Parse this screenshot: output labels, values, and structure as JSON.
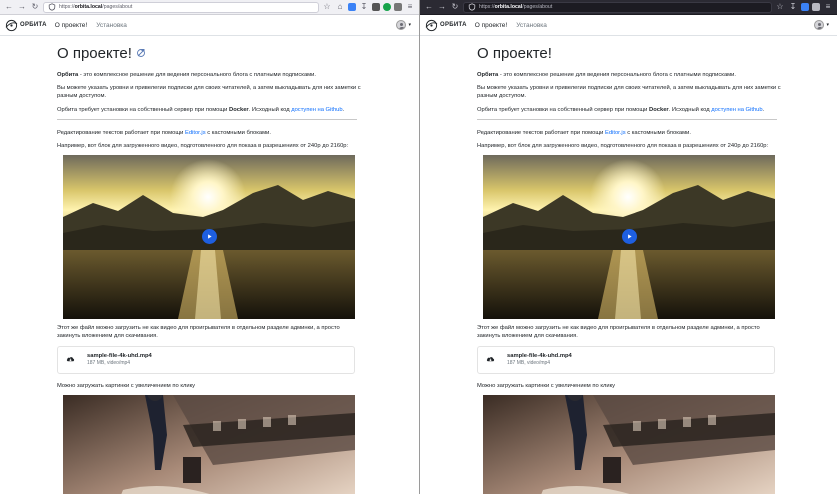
{
  "browser": {
    "url_prefix": "https://",
    "url_host": "orbita.local",
    "url_path": "/pages/about"
  },
  "site": {
    "logo_text": "ОРБИТА",
    "nav": [
      {
        "label": "О проекте!"
      },
      {
        "label": "Установка"
      }
    ]
  },
  "page": {
    "title": "О проекте!",
    "intro_bold": "Орбита",
    "intro_rest": " - это комплексное решение для ведения персонального блога с платными подписками.",
    "levels": "Вы можете указать уровни и привелегии подписки для своих читателей, а затем выкладывать для них заметки с разным доступом.",
    "docker_pre": "Орбита требует установки на собственный сервер при помощи ",
    "docker_bold": "Docker",
    "docker_mid": ". Исходный код ",
    "github_link": "доступен на Github",
    "docker_end": ".",
    "editor_pre": "Редактирование текстов работает при помощи ",
    "editor_link": "Editor.js",
    "editor_post": " с кастомными блоками.",
    "video_intro": "Например, вот блок для загруженного видео, подготовленного для показа в разрешениях от 240p до 2160p:",
    "file_intro": "Этот же файл можно загрузить не как видео для проигрывателя в отдельном разделе админки, а просто закинуть вложением для скачивания.",
    "file": {
      "name": "sample-file-4k-uhd.mp4",
      "meta": "187 MB, video/mp4"
    },
    "images_intro": "Можно загружать картинки с увеличением по клику"
  },
  "colors": {
    "link": "#0d6efd",
    "play_button": "#1e5fe0",
    "chrome_light": "#f0f0f4",
    "chrome_dark": "#2b2a33"
  },
  "icons": [
    "back-arrow-icon",
    "forward-arrow-icon",
    "reload-icon",
    "shield-icon",
    "star-icon",
    "home-icon",
    "download-icon",
    "extension-icon",
    "menu-icon",
    "play-icon",
    "cloud-download-icon"
  ]
}
